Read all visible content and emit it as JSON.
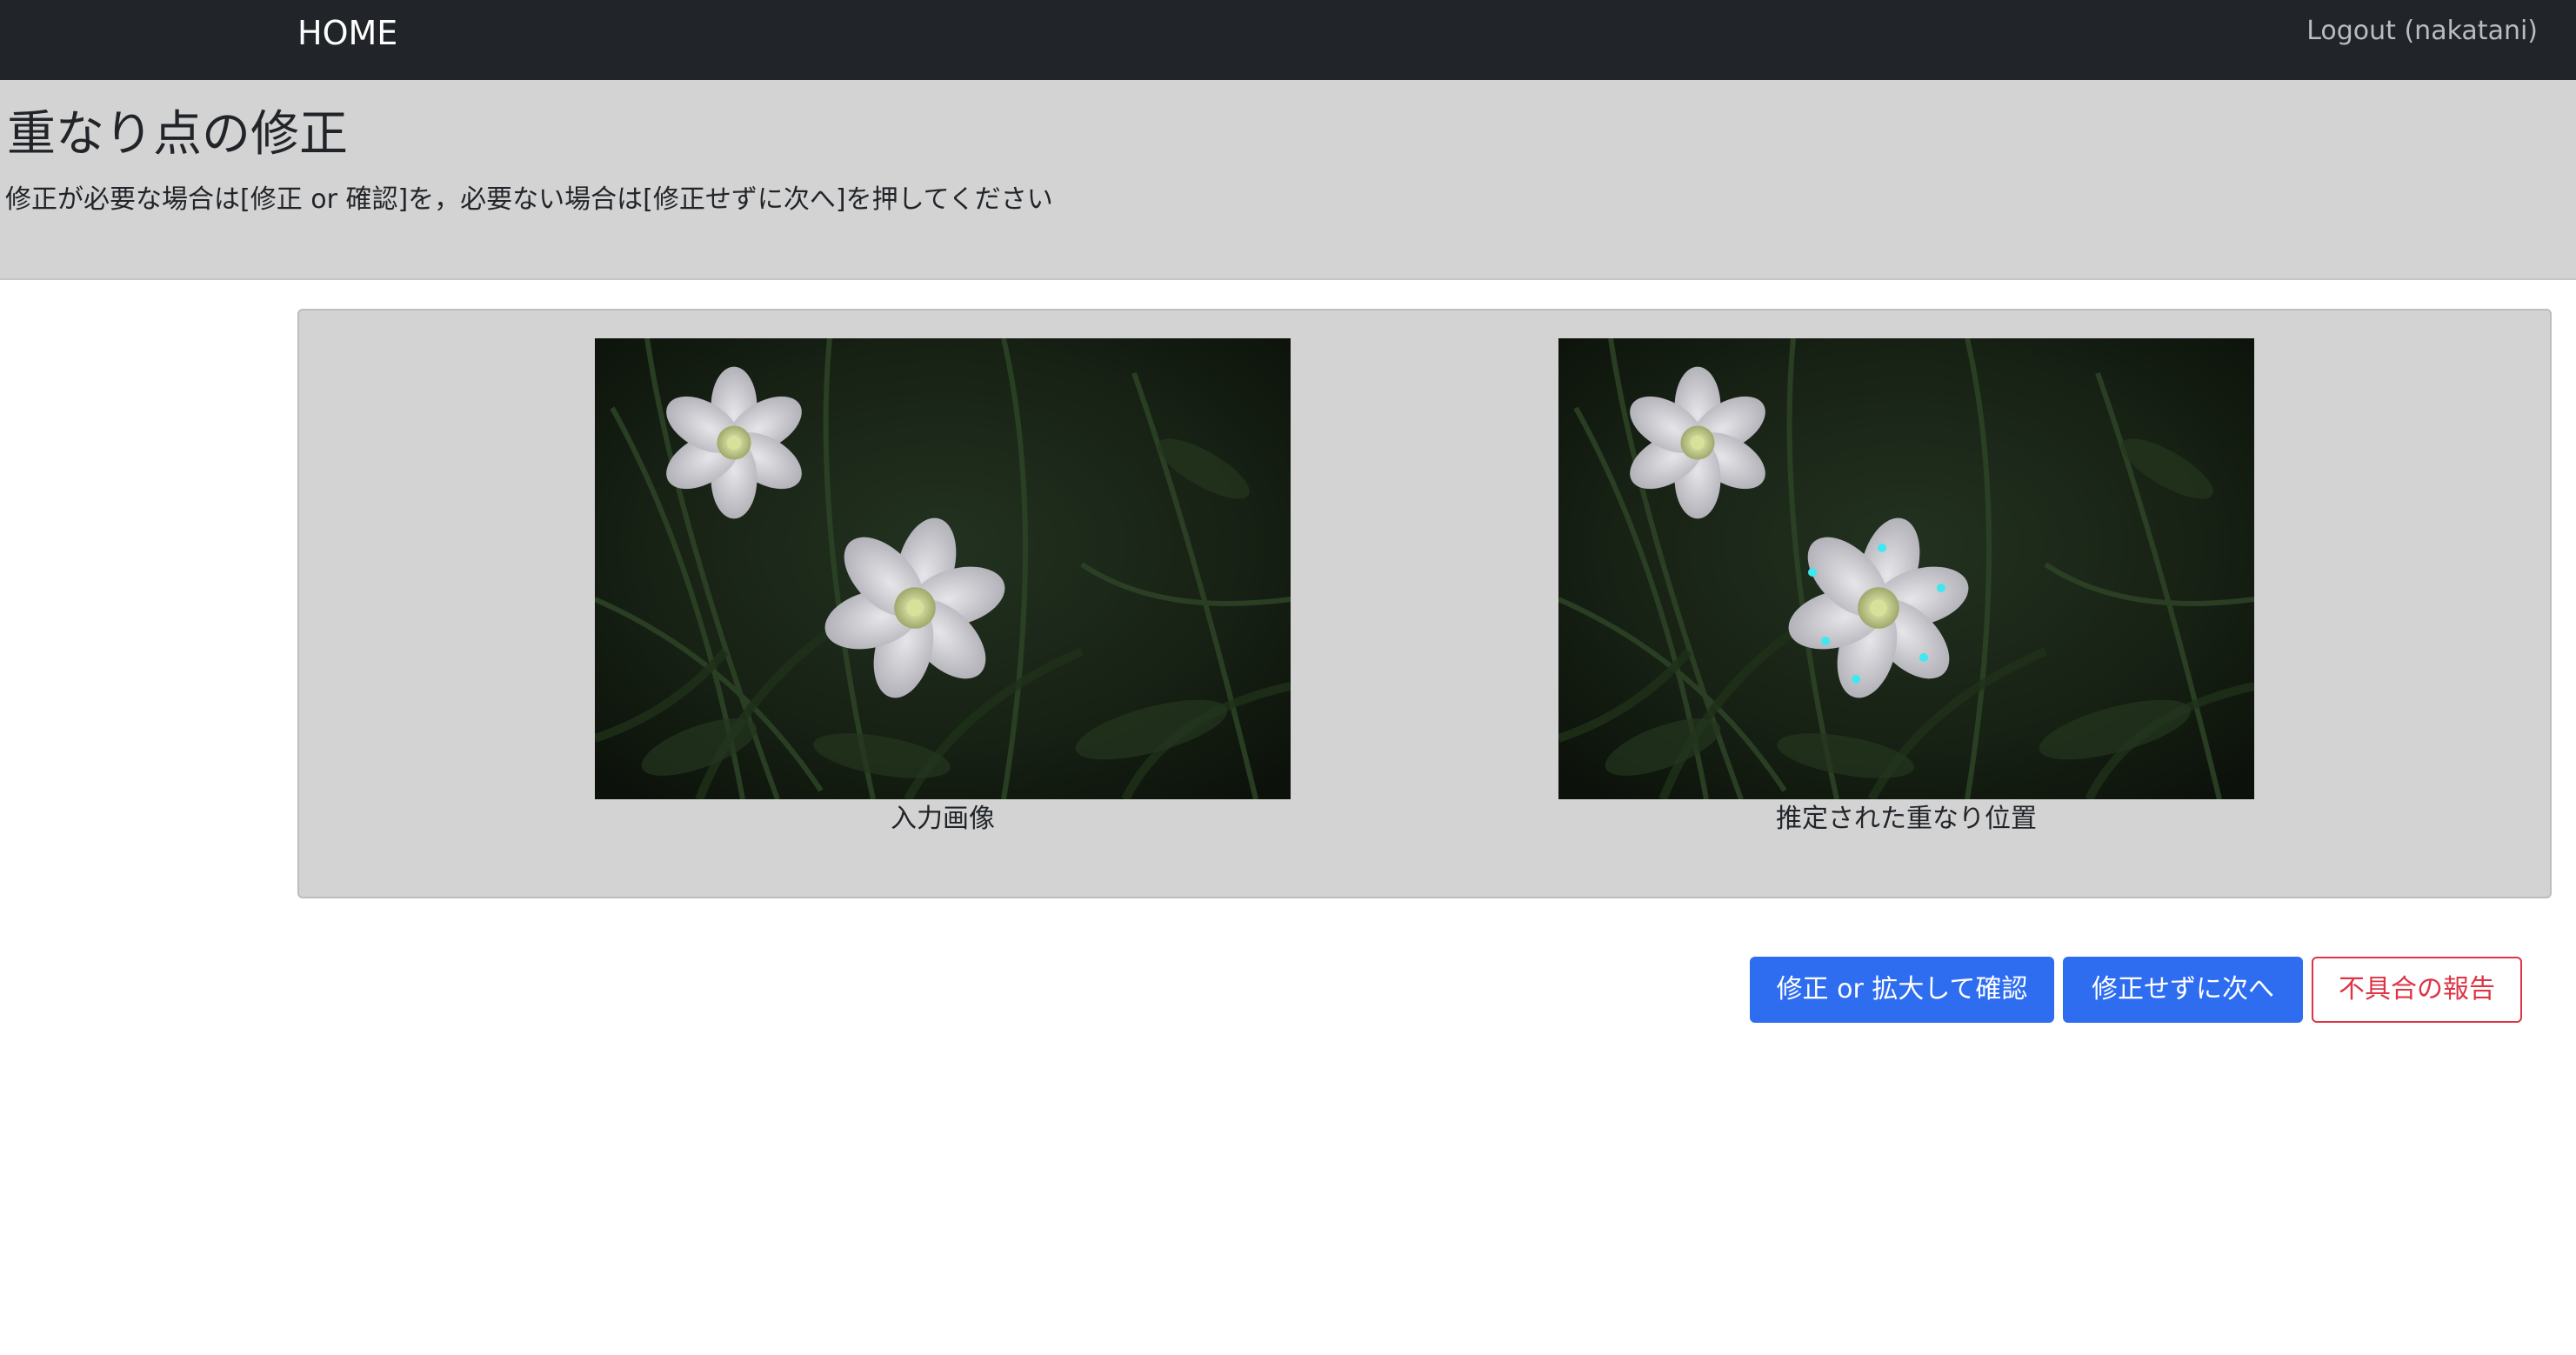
{
  "navbar": {
    "home_label": "HOME",
    "logout_label": "Logout (nakatani)"
  },
  "header": {
    "title": "重なり点の修正",
    "instruction": "修正が必要な場合は[修正 or 確認]を，必要ない場合は[修正せずに次へ]を押してください"
  },
  "images": {
    "input_caption": "入力画像",
    "estimated_caption": "推定された重なり位置"
  },
  "actions": {
    "fix_label": "修正 or 拡大して確認",
    "skip_label": "修正せずに次へ",
    "report_label": "不具合の報告"
  },
  "colors": {
    "navbar_bg": "#212529",
    "band_bg": "#d3d3d3",
    "primary": "#2f6df0",
    "danger": "#dc3545",
    "marker": "#3fe8f0"
  },
  "icons": {
    "photo_subject": "white-anemone-flowers",
    "marker": "overlap-point-marker"
  }
}
